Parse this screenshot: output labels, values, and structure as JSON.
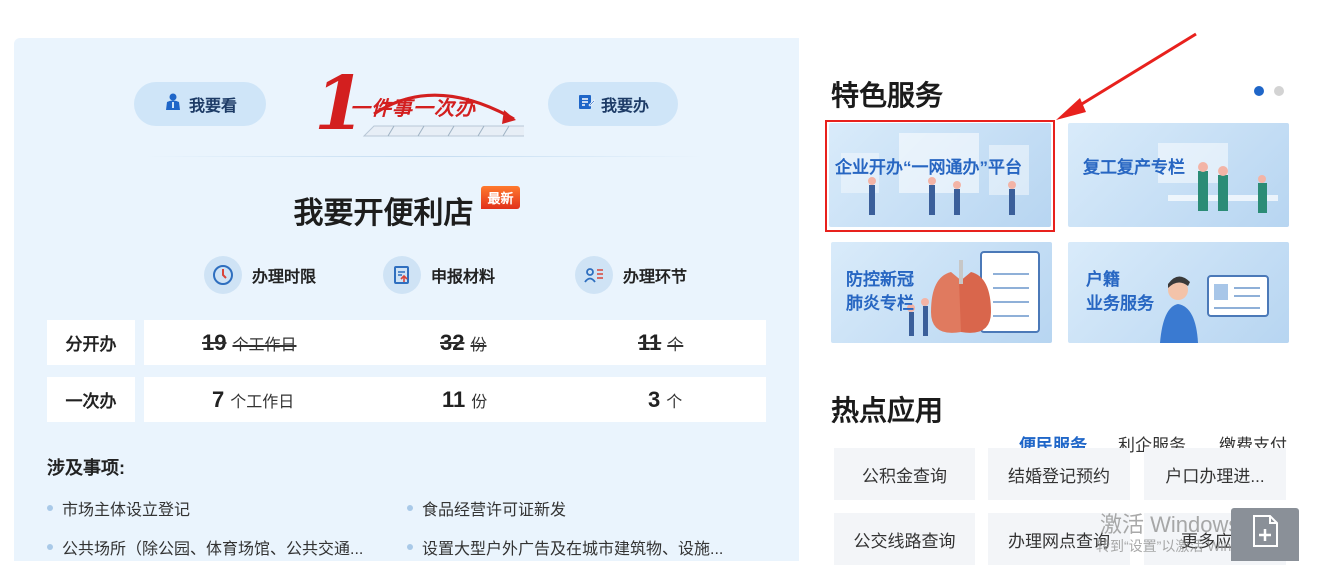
{
  "left_panel": {
    "btn_look": {
      "label": "我要看",
      "icon": "person-icon"
    },
    "btn_do": {
      "label": "我要办",
      "icon": "edit-document-icon"
    },
    "logo": {
      "text": "一件事一次办"
    },
    "title": "我要开便利店",
    "badge": "最新",
    "metrics": [
      {
        "label": "办理时限",
        "icon": "clock-icon"
      },
      {
        "label": "申报材料",
        "icon": "document-icon"
      },
      {
        "label": "办理环节",
        "icon": "person-list-icon"
      }
    ],
    "rows": [
      {
        "label": "分开办",
        "struck": true,
        "cells": [
          {
            "value": "19",
            "unit": "个工作日"
          },
          {
            "value": "32",
            "unit": "份"
          },
          {
            "value": "11",
            "unit": "个"
          }
        ]
      },
      {
        "label": "一次办",
        "struck": false,
        "cells": [
          {
            "value": "7",
            "unit": "个工作日"
          },
          {
            "value": "11",
            "unit": "份"
          },
          {
            "value": "3",
            "unit": "个"
          }
        ]
      }
    ],
    "items_title": "涉及事项:",
    "items": [
      "市场主体设立登记",
      "食品经营许可证新发",
      "公共场所（除公园、体育场馆、公共交通...",
      "设置大型户外广告及在城市建筑物、设施..."
    ]
  },
  "right_panel": {
    "special_title": "特色服务",
    "cards": [
      {
        "label": "企业开办“一网通办”平台"
      },
      {
        "label": "复工复产专栏"
      },
      {
        "label": "防控新冠\n肺炎专栏"
      },
      {
        "label": "户籍\n业务服务"
      }
    ],
    "hot_title": "热点应用",
    "tabs": [
      "便民服务",
      "利企服务",
      "缴费支付"
    ],
    "active_tab": "便民服务",
    "apps": [
      "公积金查询",
      "结婚登记预约",
      "户口办理进...",
      "公交线路查询",
      "办理网点查询",
      "更多应用"
    ]
  },
  "watermark": {
    "line1": "激活 Windows",
    "line2": "转到“设置”以激活 Windows。"
  },
  "colors": {
    "accent": "#1f66c8",
    "highlight": "#e8211d",
    "panel_bg": "#eaf4fd"
  }
}
